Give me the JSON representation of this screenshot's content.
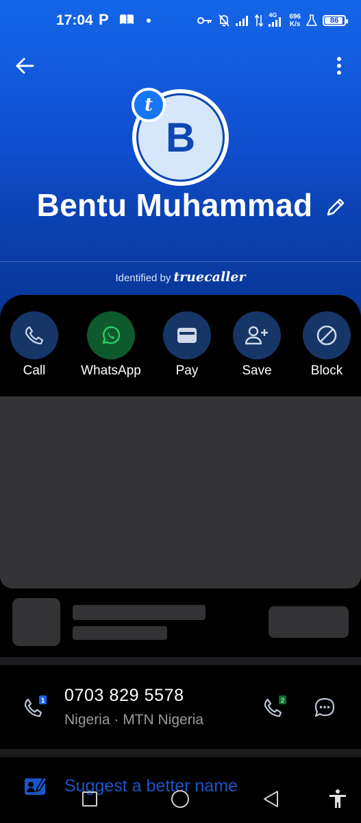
{
  "status_bar": {
    "time": "17:04",
    "p_label": "P",
    "network_speed": "696",
    "network_unit": "K/s",
    "network_type": "4G",
    "battery": "86"
  },
  "contact": {
    "initial": "B",
    "badge_letter": "t",
    "name": "Bentu Muhammad",
    "identified_by": "Identified by",
    "brand": "truecaller"
  },
  "actions": [
    {
      "label": "Call",
      "icon": "phone-icon"
    },
    {
      "label": "WhatsApp",
      "icon": "whatsapp-icon"
    },
    {
      "label": "Pay",
      "icon": "wallet-icon"
    },
    {
      "label": "Save",
      "icon": "add-person-icon"
    },
    {
      "label": "Block",
      "icon": "block-icon"
    }
  ],
  "number": {
    "value": "0703 829 5578",
    "details": "Nigeria · MTN Nigeria",
    "sim1": "1",
    "sim2": "2"
  },
  "suggest": {
    "label": "Suggest a better name"
  },
  "colors": {
    "header_top": "#1565e8",
    "header_bottom": "#0a3596",
    "action_circle": "#173668",
    "whatsapp_circle": "#0f5a2c",
    "whatsapp_green": "#25d366",
    "accent_blue": "#1a56c8"
  }
}
